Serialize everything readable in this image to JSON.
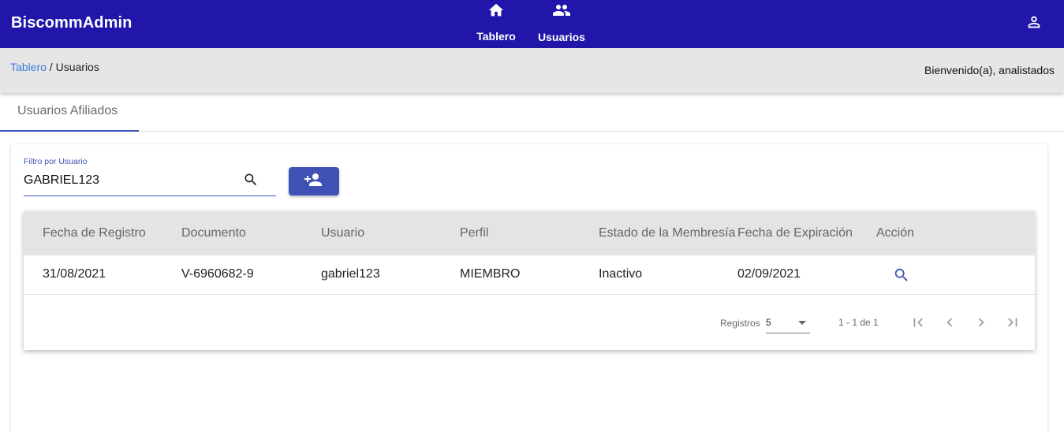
{
  "app": {
    "title": "BiscommAdmin"
  },
  "nav": {
    "items": [
      {
        "label": "Tablero",
        "icon": "home-icon"
      },
      {
        "label": "Usuarios",
        "icon": "people-icon"
      }
    ],
    "account_icon": "account-icon"
  },
  "breadcrumb": {
    "root": "Tablero",
    "separator": " / ",
    "current": "Usuarios"
  },
  "welcome": "Bienvenido(a), analistados",
  "tabs": [
    {
      "label": "Usuarios Afiliados",
      "active": true
    }
  ],
  "filter": {
    "label": "Filtro por Usuario",
    "value": "GABRIEL123",
    "icon": "search-icon"
  },
  "add_button": {
    "icon": "person-add-icon"
  },
  "table": {
    "columns": [
      "Fecha de Registro",
      "Documento",
      "Usuario",
      "Perfil",
      "Estado de la Membresía",
      "Fecha de Expiración",
      "Acción"
    ],
    "rows": [
      {
        "fecha_registro": "31/08/2021",
        "documento": "V-6960682-9",
        "usuario": "gabriel123",
        "perfil": "MIEMBRO",
        "estado": "Inactivo",
        "fecha_expiracion": "02/09/2021",
        "accion_icon": "search-icon"
      }
    ]
  },
  "paginator": {
    "items_label": "Registros",
    "page_size": "5",
    "range": "1 - 1 de 1",
    "icons": [
      "first-page-icon",
      "prev-page-icon",
      "next-page-icon",
      "last-page-icon"
    ]
  },
  "colors": {
    "header": "#2116a9",
    "primary": "#3f51b5",
    "link": "#3c7ddc",
    "subbar": "#e6e6e6"
  }
}
